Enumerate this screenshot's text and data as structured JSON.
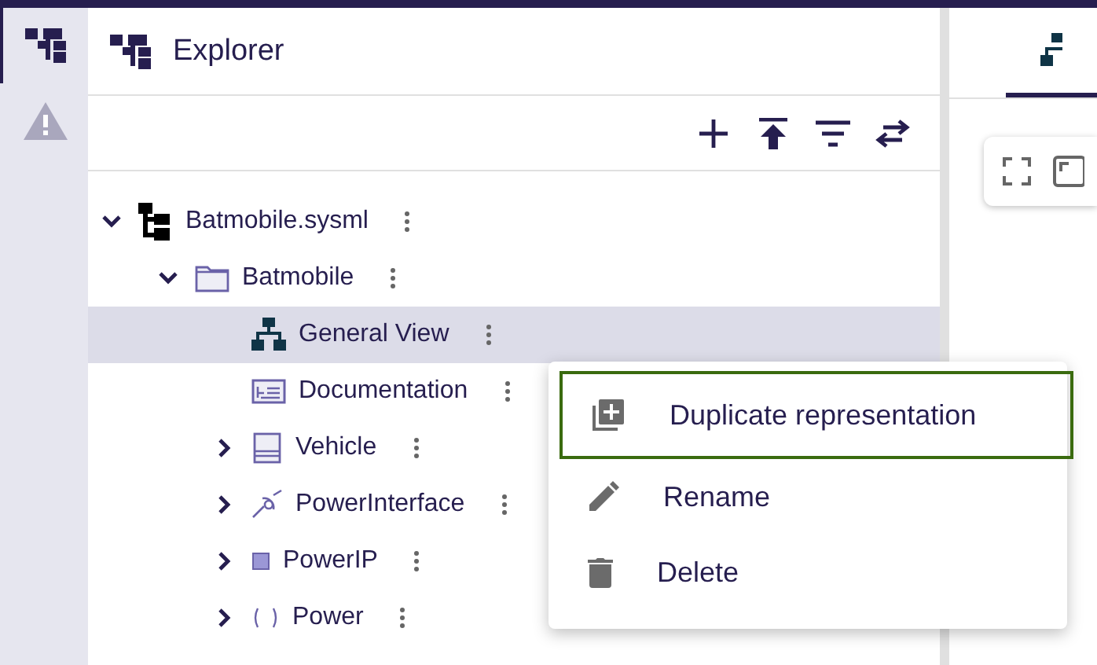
{
  "explorer": {
    "title": "Explorer"
  },
  "tree": [
    {
      "label": "Batmobile.sysml",
      "kind": "model",
      "expanded": true,
      "selected": false,
      "children": [
        {
          "label": "Batmobile",
          "kind": "folder",
          "expanded": true,
          "selected": false,
          "children": [
            {
              "label": "General View",
              "kind": "diagram",
              "selected": true
            },
            {
              "label": "Documentation",
              "kind": "documentation",
              "selected": false
            },
            {
              "label": "Vehicle",
              "kind": "part",
              "expanded": false,
              "selected": false
            },
            {
              "label": "PowerInterface",
              "kind": "interface",
              "expanded": false,
              "selected": false
            },
            {
              "label": "PowerIP",
              "kind": "port",
              "expanded": false,
              "selected": false
            },
            {
              "label": "Power",
              "kind": "attribute",
              "expanded": false,
              "selected": false
            }
          ]
        }
      ]
    }
  ],
  "context_menu": [
    {
      "label": "Duplicate representation",
      "kind": "duplicate",
      "selected": true
    },
    {
      "label": "Rename",
      "kind": "rename",
      "selected": false
    },
    {
      "label": "Delete",
      "kind": "delete",
      "selected": false
    }
  ]
}
